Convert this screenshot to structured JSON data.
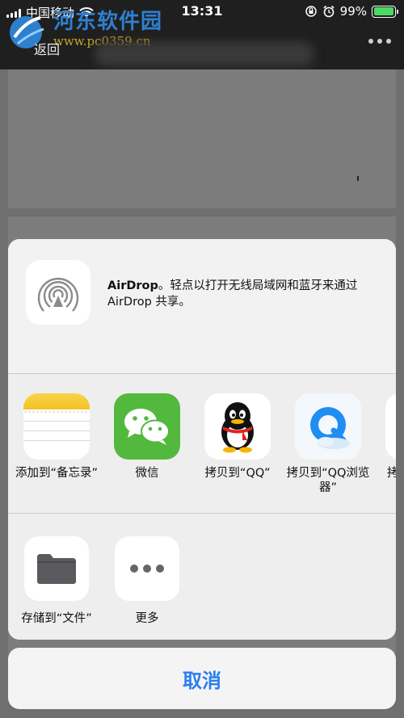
{
  "status_bar": {
    "carrier": "中国移动",
    "time": "13:31",
    "battery": "99%",
    "battery_level": 0.99,
    "battery_color": "#4cd964"
  },
  "watermark": {
    "title": "河东软件园",
    "url": "www.pc0359.cn"
  },
  "nav": {
    "back_label": "返回"
  },
  "share_sheet": {
    "airdrop": {
      "title": "AirDrop",
      "description": "。轻点以打开无线局域网和蓝牙来通过 AirDrop 共享。"
    },
    "apps": [
      {
        "label": "添加到“备忘录”",
        "icon": "notes-icon"
      },
      {
        "label": "微信",
        "icon": "wechat-icon"
      },
      {
        "label": "拷贝到“QQ”",
        "icon": "qq-icon"
      },
      {
        "label": "拷贝到“QQ浏览器”",
        "icon": "qq-browser-icon"
      },
      {
        "label": "拷",
        "icon": "partial-app-icon"
      }
    ],
    "actions": [
      {
        "label": "存储到“文件”",
        "icon": "folder-icon"
      },
      {
        "label": "更多",
        "icon": "more-icon"
      }
    ],
    "cancel_label": "取消"
  },
  "colors": {
    "accent": "#2a7ef0",
    "wechat_green": "#53b93e"
  }
}
